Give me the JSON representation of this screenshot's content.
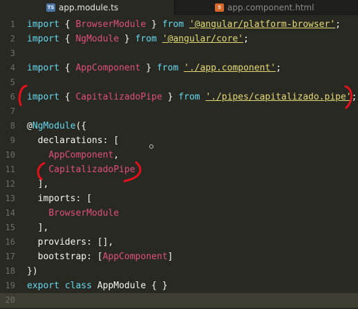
{
  "tabs": [
    {
      "label": "app.module.ts",
      "icon": "TS",
      "active": true
    },
    {
      "label": "app.component.html",
      "icon": "5",
      "active": false
    }
  ],
  "colors": {
    "editor_bg": "#282923",
    "tab_bg": "#1e1f1c",
    "keyword": "#66d9ef",
    "string": "#e6db74",
    "class_name": "#e0507a",
    "annotation_marker": "#e8101b"
  },
  "lines": [
    {
      "n": "1",
      "parts": [
        {
          "t": "import",
          "c": "kw"
        },
        {
          "t": " { ",
          "c": "punc"
        },
        {
          "t": "BrowserModule",
          "c": "red-id"
        },
        {
          "t": " } ",
          "c": "punc"
        },
        {
          "t": "from",
          "c": "kw"
        },
        {
          "t": " ",
          "c": "punc"
        },
        {
          "t": "'@angular/platform-browser'",
          "c": "str"
        },
        {
          "t": ";",
          "c": "punc"
        }
      ]
    },
    {
      "n": "2",
      "parts": [
        {
          "t": "import",
          "c": "kw"
        },
        {
          "t": " { ",
          "c": "punc"
        },
        {
          "t": "NgModule",
          "c": "red-id"
        },
        {
          "t": " } ",
          "c": "punc"
        },
        {
          "t": "from",
          "c": "kw"
        },
        {
          "t": " ",
          "c": "punc"
        },
        {
          "t": "'@angular/core'",
          "c": "str"
        },
        {
          "t": ";",
          "c": "punc"
        }
      ]
    },
    {
      "n": "3",
      "parts": []
    },
    {
      "n": "4",
      "parts": [
        {
          "t": "import",
          "c": "kw"
        },
        {
          "t": " { ",
          "c": "punc"
        },
        {
          "t": "AppComponent",
          "c": "red-id"
        },
        {
          "t": " } ",
          "c": "punc"
        },
        {
          "t": "from",
          "c": "kw"
        },
        {
          "t": " ",
          "c": "punc"
        },
        {
          "t": "'./app.component'",
          "c": "str"
        },
        {
          "t": ";",
          "c": "punc"
        }
      ]
    },
    {
      "n": "5",
      "parts": []
    },
    {
      "n": "6",
      "parts": [
        {
          "t": "import",
          "c": "kw"
        },
        {
          "t": " { ",
          "c": "punc"
        },
        {
          "t": "CapitalizadoPipe",
          "c": "red-id"
        },
        {
          "t": " } ",
          "c": "punc"
        },
        {
          "t": "from",
          "c": "kw"
        },
        {
          "t": " ",
          "c": "punc"
        },
        {
          "t": "'./pipes/capitalizado.pipe'",
          "c": "str"
        },
        {
          "t": ";",
          "c": "punc"
        }
      ]
    },
    {
      "n": "7",
      "parts": []
    },
    {
      "n": "8",
      "parts": [
        {
          "t": "@",
          "c": "punc"
        },
        {
          "t": "NgModule",
          "c": "kw"
        },
        {
          "t": "({",
          "c": "punc"
        }
      ]
    },
    {
      "n": "9",
      "parts": [
        {
          "t": "  declarations: [",
          "c": "punc"
        }
      ]
    },
    {
      "n": "10",
      "parts": [
        {
          "t": "    ",
          "c": "punc"
        },
        {
          "t": "AppComponent",
          "c": "red-id"
        },
        {
          "t": ",",
          "c": "punc"
        }
      ]
    },
    {
      "n": "11",
      "parts": [
        {
          "t": "    ",
          "c": "punc"
        },
        {
          "t": "CapitalizadoPipe",
          "c": "red-id"
        }
      ]
    },
    {
      "n": "12",
      "parts": [
        {
          "t": "  ],",
          "c": "punc"
        }
      ]
    },
    {
      "n": "13",
      "parts": [
        {
          "t": "  imports: [",
          "c": "punc"
        }
      ]
    },
    {
      "n": "14",
      "parts": [
        {
          "t": "    ",
          "c": "punc"
        },
        {
          "t": "BrowserModule",
          "c": "red-id"
        }
      ]
    },
    {
      "n": "15",
      "parts": [
        {
          "t": "  ],",
          "c": "punc"
        }
      ]
    },
    {
      "n": "16",
      "parts": [
        {
          "t": "  providers: [],",
          "c": "punc"
        }
      ]
    },
    {
      "n": "17",
      "parts": [
        {
          "t": "  bootstrap: [",
          "c": "punc"
        },
        {
          "t": "AppComponent",
          "c": "red-id"
        },
        {
          "t": "]",
          "c": "punc"
        }
      ]
    },
    {
      "n": "18",
      "parts": [
        {
          "t": "})",
          "c": "punc"
        }
      ]
    },
    {
      "n": "19",
      "parts": [
        {
          "t": "export",
          "c": "kw"
        },
        {
          "t": " ",
          "c": "punc"
        },
        {
          "t": "class",
          "c": "kw"
        },
        {
          "t": " AppModule { }",
          "c": "punc"
        }
      ]
    },
    {
      "n": "20",
      "parts": []
    }
  ],
  "current_line": "20"
}
